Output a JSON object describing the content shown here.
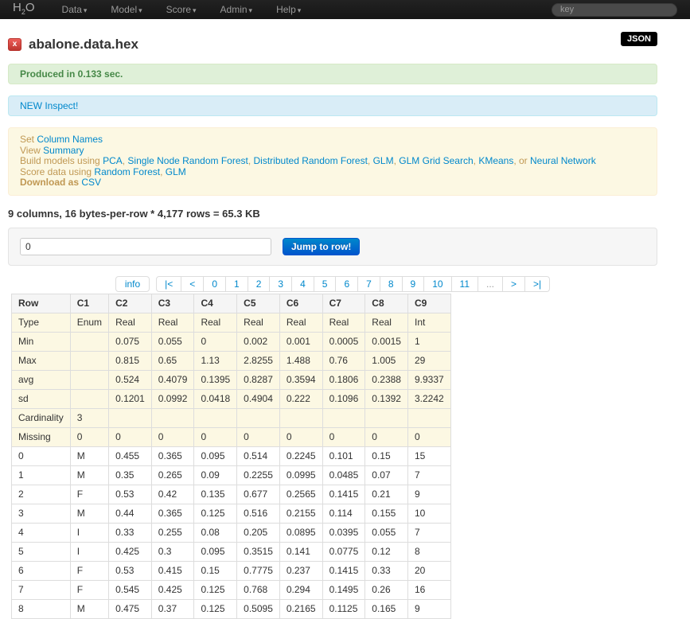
{
  "navbar": {
    "brand": {
      "h": "H",
      "sub": "2",
      "o": "O"
    },
    "menus": [
      {
        "label": "Data"
      },
      {
        "label": "Model"
      },
      {
        "label": "Score"
      },
      {
        "label": "Admin"
      },
      {
        "label": "Help"
      }
    ],
    "search_placeholder": "key"
  },
  "header": {
    "close_label": "x",
    "title": "abalone.data.hex",
    "json_button": "JSON"
  },
  "alerts": {
    "success": "Produced in 0.133 sec.",
    "info_link": "NEW Inspect!"
  },
  "actions": {
    "lines": [
      {
        "segments": [
          {
            "t": "Set ",
            "link": false
          },
          {
            "t": "Column Names",
            "link": true
          }
        ]
      },
      {
        "segments": [
          {
            "t": "View ",
            "link": false
          },
          {
            "t": "Summary",
            "link": true
          }
        ]
      },
      {
        "segments": [
          {
            "t": "Build models using ",
            "link": false
          },
          {
            "t": "PCA",
            "link": true
          },
          {
            "t": ", ",
            "link": false
          },
          {
            "t": "Single Node Random Forest",
            "link": true
          },
          {
            "t": ", ",
            "link": false
          },
          {
            "t": "Distributed Random Forest",
            "link": true
          },
          {
            "t": ", ",
            "link": false
          },
          {
            "t": "GLM",
            "link": true
          },
          {
            "t": ", ",
            "link": false
          },
          {
            "t": "GLM Grid Search",
            "link": true
          },
          {
            "t": ", ",
            "link": false
          },
          {
            "t": "KMeans",
            "link": true
          },
          {
            "t": ", or ",
            "link": false
          },
          {
            "t": "Neural Network",
            "link": true
          }
        ]
      },
      {
        "segments": [
          {
            "t": "Score data using ",
            "link": false
          },
          {
            "t": "Random Forest",
            "link": true
          },
          {
            "t": ", ",
            "link": false
          },
          {
            "t": "GLM",
            "link": true
          }
        ]
      },
      {
        "segments": [
          {
            "t": "Download as ",
            "link": false,
            "bold": true
          },
          {
            "t": "CSV",
            "link": true
          }
        ]
      }
    ]
  },
  "summary": "9 columns, 16 bytes-per-row * 4,177 rows = 65.3 KB",
  "jump": {
    "value": "0",
    "button": "Jump to row!"
  },
  "pagination": {
    "info": "info",
    "items": [
      {
        "label": "|<",
        "name": "page-first"
      },
      {
        "label": "<",
        "name": "page-prev"
      },
      {
        "label": "0",
        "name": "page-0"
      },
      {
        "label": "1",
        "name": "page-1"
      },
      {
        "label": "2",
        "name": "page-2"
      },
      {
        "label": "3",
        "name": "page-3"
      },
      {
        "label": "4",
        "name": "page-4"
      },
      {
        "label": "5",
        "name": "page-5"
      },
      {
        "label": "6",
        "name": "page-6"
      },
      {
        "label": "7",
        "name": "page-7"
      },
      {
        "label": "8",
        "name": "page-8"
      },
      {
        "label": "9",
        "name": "page-9"
      },
      {
        "label": "10",
        "name": "page-10"
      },
      {
        "label": "11",
        "name": "page-11"
      },
      {
        "label": "...",
        "name": "page-ellipsis",
        "disabled": true
      },
      {
        "label": ">",
        "name": "page-next"
      },
      {
        "label": ">|",
        "name": "page-last"
      }
    ]
  },
  "table": {
    "columns": [
      "Row",
      "C1",
      "C2",
      "C3",
      "C4",
      "C5",
      "C6",
      "C7",
      "C8",
      "C9"
    ],
    "stat_rows": [
      [
        "Type",
        "Enum",
        "Real",
        "Real",
        "Real",
        "Real",
        "Real",
        "Real",
        "Real",
        "Int"
      ],
      [
        "Min",
        "",
        "0.075",
        "0.055",
        "0",
        "0.002",
        "0.001",
        "0.0005",
        "0.0015",
        "1"
      ],
      [
        "Max",
        "",
        "0.815",
        "0.65",
        "1.13",
        "2.8255",
        "1.488",
        "0.76",
        "1.005",
        "29"
      ],
      [
        "avg",
        "",
        "0.524",
        "0.4079",
        "0.1395",
        "0.8287",
        "0.3594",
        "0.1806",
        "0.2388",
        "9.9337"
      ],
      [
        "sd",
        "",
        "0.1201",
        "0.0992",
        "0.0418",
        "0.4904",
        "0.222",
        "0.1096",
        "0.1392",
        "3.2242"
      ],
      [
        "Cardinality",
        "3",
        "",
        "",
        "",
        "",
        "",
        "",
        "",
        ""
      ],
      [
        "Missing",
        "0",
        "0",
        "0",
        "0",
        "0",
        "0",
        "0",
        "0",
        "0"
      ]
    ],
    "data_rows": [
      [
        "0",
        "M",
        "0.455",
        "0.365",
        "0.095",
        "0.514",
        "0.2245",
        "0.101",
        "0.15",
        "15"
      ],
      [
        "1",
        "M",
        "0.35",
        "0.265",
        "0.09",
        "0.2255",
        "0.0995",
        "0.0485",
        "0.07",
        "7"
      ],
      [
        "2",
        "F",
        "0.53",
        "0.42",
        "0.135",
        "0.677",
        "0.2565",
        "0.1415",
        "0.21",
        "9"
      ],
      [
        "3",
        "M",
        "0.44",
        "0.365",
        "0.125",
        "0.516",
        "0.2155",
        "0.114",
        "0.155",
        "10"
      ],
      [
        "4",
        "I",
        "0.33",
        "0.255",
        "0.08",
        "0.205",
        "0.0895",
        "0.0395",
        "0.055",
        "7"
      ],
      [
        "5",
        "I",
        "0.425",
        "0.3",
        "0.095",
        "0.3515",
        "0.141",
        "0.0775",
        "0.12",
        "8"
      ],
      [
        "6",
        "F",
        "0.53",
        "0.415",
        "0.15",
        "0.7775",
        "0.237",
        "0.1415",
        "0.33",
        "20"
      ],
      [
        "7",
        "F",
        "0.545",
        "0.425",
        "0.125",
        "0.768",
        "0.294",
        "0.1495",
        "0.26",
        "16"
      ],
      [
        "8",
        "M",
        "0.475",
        "0.37",
        "0.125",
        "0.5095",
        "0.2165",
        "0.1125",
        "0.165",
        "9"
      ]
    ]
  },
  "colors": {
    "navbar_bg": "#1b1b1b",
    "link": "#0088cc",
    "success_bg": "#dff0d8",
    "success_text": "#468847",
    "info_bg": "#d9edf7",
    "warning_bg": "#fcf8e3",
    "warning_text": "#c09853",
    "primary_button": "#0066cc",
    "stat_row_bg": "#fcf8e3",
    "danger_badge": "#bd362f"
  }
}
